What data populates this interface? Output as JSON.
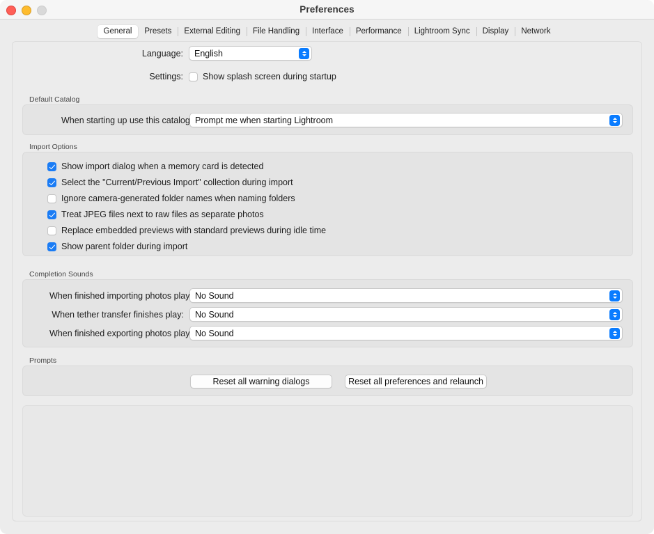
{
  "window": {
    "title": "Preferences",
    "traffic_lights": [
      {
        "name": "close",
        "color": "#ff5f57"
      },
      {
        "name": "minimize",
        "color": "#febc2e"
      },
      {
        "name": "zoom",
        "color": "#d9d9d9"
      }
    ]
  },
  "tabs": [
    {
      "label": "General",
      "selected": true
    },
    {
      "label": "Presets",
      "selected": false
    },
    {
      "label": "External Editing",
      "selected": false
    },
    {
      "label": "File Handling",
      "selected": false
    },
    {
      "label": "Interface",
      "selected": false
    },
    {
      "label": "Performance",
      "selected": false
    },
    {
      "label": "Lightroom Sync",
      "selected": false
    },
    {
      "label": "Display",
      "selected": false
    },
    {
      "label": "Network",
      "selected": false
    }
  ],
  "general": {
    "language": {
      "label": "Language:",
      "value": "English"
    },
    "settings": {
      "label": "Settings:",
      "splash_label": "Show splash screen during startup",
      "splash_checked": false
    },
    "default_catalog": {
      "group_title": "Default Catalog",
      "label": "When starting up use this catalog:",
      "value": "Prompt me when starting Lightroom"
    },
    "import_options": {
      "group_title": "Import Options",
      "items": [
        {
          "label": "Show import dialog when a memory card is detected",
          "checked": true
        },
        {
          "label": "Select the \"Current/Previous Import\" collection during import",
          "checked": true
        },
        {
          "label": "Ignore camera-generated folder names when naming folders",
          "checked": false
        },
        {
          "label": "Treat JPEG files next to raw files as separate photos",
          "checked": true
        },
        {
          "label": "Replace embedded previews with standard previews during idle time",
          "checked": false
        },
        {
          "label": "Show parent folder during import",
          "checked": true
        }
      ]
    },
    "completion_sounds": {
      "group_title": "Completion Sounds",
      "rows": [
        {
          "label": "When finished importing photos play:",
          "value": "No Sound"
        },
        {
          "label": "When tether transfer finishes play:",
          "value": "No Sound"
        },
        {
          "label": "When finished exporting photos play:",
          "value": "No Sound"
        }
      ]
    },
    "prompts": {
      "group_title": "Prompts",
      "reset_warnings_label": "Reset all warning dialogs",
      "reset_prefs_label": "Reset all preferences and relaunch"
    }
  },
  "colors": {
    "accent": "#1a7cf5",
    "stepper": "#0a7cff",
    "window_bg": "#ececec",
    "group_bg": "#e4e4e4"
  }
}
